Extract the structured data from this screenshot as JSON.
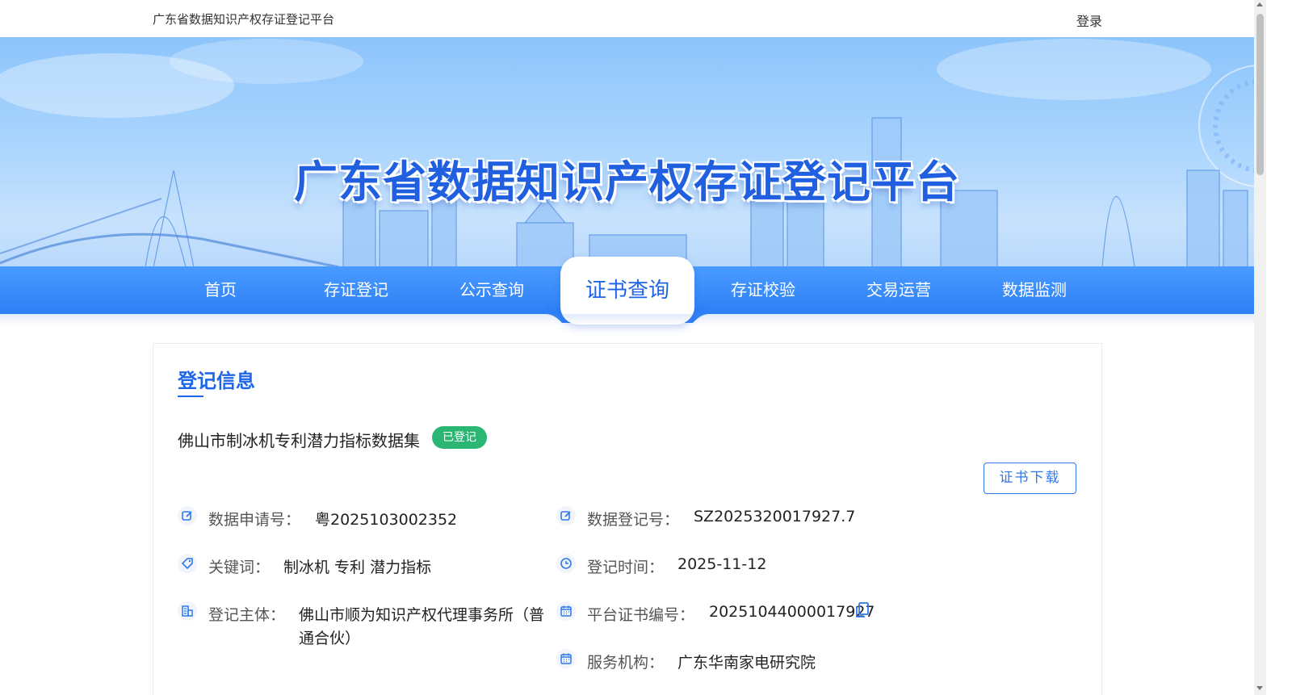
{
  "header": {
    "site_name": "广东省数据知识产权存证登记平台",
    "login_label": "登录"
  },
  "banner": {
    "title": "广东省数据知识产权存证登记平台"
  },
  "nav": {
    "items": [
      "首页",
      "存证登记",
      "公示查询",
      "证书查询",
      "存证校验",
      "交易运营",
      "数据监测"
    ],
    "active_index": 3
  },
  "card": {
    "section_title": "登记信息",
    "record_name": "佛山市制冰机专利潜力指标数据集",
    "status": "已登记",
    "download_label": "证书下载",
    "fields": {
      "application_no": {
        "label": "数据申请号：",
        "value": "粤2025103002352"
      },
      "registration_no": {
        "label": "数据登记号：",
        "value": "SZ2025320017927.7"
      },
      "keywords": {
        "label": "关键词：",
        "value": "制冰机 专利 潜力指标"
      },
      "registration_time": {
        "label": "登记时间：",
        "value": "2025-11-12"
      },
      "subject": {
        "label": "登记主体：",
        "value_line1": "佛山市顺为知识产权代理事务所（普",
        "value_line2": "通合伙）"
      },
      "certificate_no": {
        "label": "平台证书编号：",
        "value": "20251044000017927"
      },
      "service_org": {
        "label": "服务机构：",
        "value": "广东华南家电研究院"
      }
    }
  },
  "colors": {
    "accent": "#1f66e6",
    "nav_bg": "#2d7ff5",
    "status_green": "#2bb673"
  }
}
